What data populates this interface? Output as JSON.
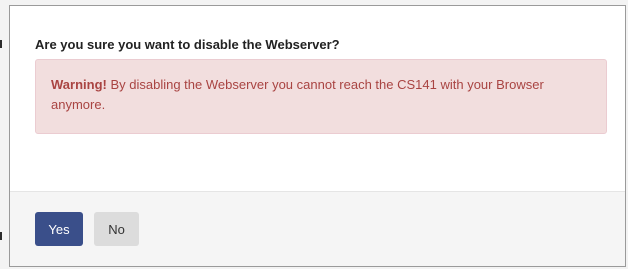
{
  "dialog": {
    "question": "Are you sure you want to disable the Webserver?",
    "warning_label": "Warning!",
    "warning_text": " By disabling the Webserver you cannot reach the CS141 with your Browser anymore."
  },
  "buttons": {
    "yes_label": "Yes",
    "no_label": "No"
  },
  "colors": {
    "yes_button_bg": "#3a4f8a",
    "alert_bg": "#f2dede",
    "alert_text": "#a94442"
  }
}
